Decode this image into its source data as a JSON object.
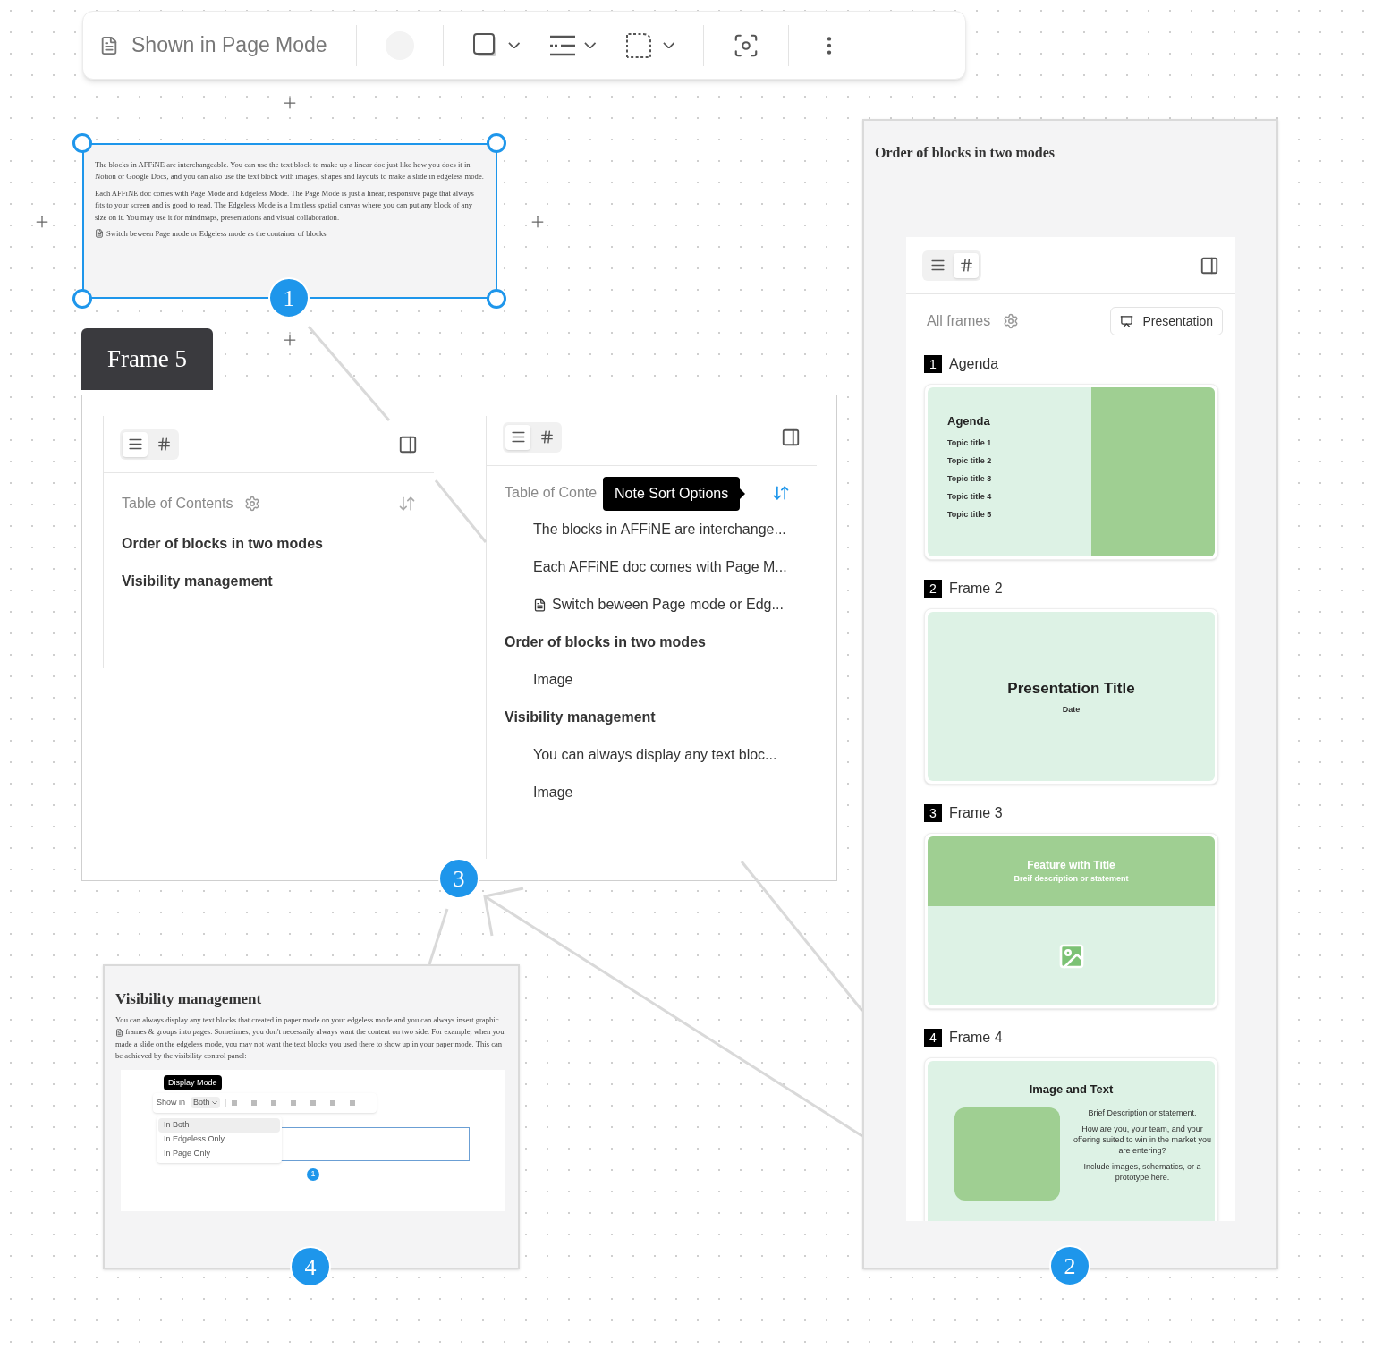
{
  "toolbar": {
    "label": "Shown in Page Mode"
  },
  "note_1": {
    "paragraphs": [
      "The blocks in AFFiNE are interchangeable. You can use the text block to make up a linear doc just like how you does it in Notion or Google Docs, and you can also use the text block with images, shapes and layouts to make a slide in edgeless mode.",
      "Each AFFiNE doc comes with Page Mode and Edgeless Mode. The Page Mode is just a linear, responsive page that always fits to your screen and is good to read. The Edgeless Mode is a limitless spatial canvas where you can put any block of any size on it. You may use it for mindmaps, presentations and visual collaboration."
    ],
    "link": "Switch beween Page mode or Edgeless mode as the container of blocks",
    "badge": "1"
  },
  "frame_label": "Frame 5",
  "frame_5": {
    "badge": "3",
    "left_panel": {
      "view_toggle": [
        {
          "kind": "outline",
          "selected": true
        },
        {
          "kind": "frames",
          "selected": false
        }
      ],
      "heading": "Table of Contents",
      "sort_active": false,
      "items": [
        "Order of blocks in two modes",
        "Visibility management"
      ]
    },
    "right_panel": {
      "view_toggle": [
        {
          "kind": "outline",
          "selected": true
        },
        {
          "kind": "frames",
          "selected": false
        }
      ],
      "heading": "Table of Conte",
      "tooltip": "Note Sort Options",
      "sort_active": true,
      "items": [
        {
          "kind": "child",
          "text": "The blocks in AFFiNE are interchange..."
        },
        {
          "kind": "child",
          "text": "Each AFFiNE doc comes with Page M..."
        },
        {
          "kind": "link",
          "text": "Switch beween Page mode or Edg..."
        },
        {
          "kind": "heading",
          "text": "Order of blocks in two modes"
        },
        {
          "kind": "child",
          "text": "Image"
        },
        {
          "kind": "heading",
          "text": "Visibility management"
        },
        {
          "kind": "child",
          "text": "You can always display any text bloc..."
        },
        {
          "kind": "child",
          "text": "Image"
        }
      ]
    }
  },
  "note_4": {
    "title": "Visibility management",
    "body_before": "You can always display any text blocks that created in paper mode on your edgeless mode and you can always insert graphic",
    "body_link": "frames & groups",
    "body_after": "into pages. Sometimes, you don't necessaily always want the content on two side. For example, when you made a slide on the edgeless mode, you may not want the text blocks you used there to show up in your paper mode. This can be achieved by the visibility control panel:",
    "screenshot": {
      "tooltip": "Display Mode",
      "show_in": "Show in",
      "value": "Both",
      "options": [
        {
          "label": "In Both",
          "selected": true
        },
        {
          "label": "In Edgeless Only",
          "selected": false
        },
        {
          "label": "In Page Only",
          "selected": false
        }
      ],
      "badge": "1"
    },
    "badge": "4"
  },
  "note_2": {
    "title": "Order of blocks in two modes",
    "badge": "2",
    "panel": {
      "view_toggle": [
        {
          "kind": "outline",
          "selected": false
        },
        {
          "kind": "frames",
          "selected": true
        }
      ],
      "filter": "All frames",
      "button": "Presentation",
      "frames": [
        {
          "number": "1",
          "name": "Agenda",
          "kind": "agenda",
          "title": "Agenda",
          "lines": [
            "Topic title 1",
            "Topic title 2",
            "Topic title 3",
            "Topic title 4",
            "Topic title 5"
          ]
        },
        {
          "number": "2",
          "name": "Frame 2",
          "kind": "title",
          "title": "Presentation Title",
          "lines": [
            "Date"
          ]
        },
        {
          "number": "3",
          "name": "Frame 3",
          "kind": "feature",
          "title": "Feature with Title",
          "lines": [
            "Breif description or statement"
          ]
        },
        {
          "number": "4",
          "name": "Frame 4",
          "kind": "image_text",
          "title": "Image and Text",
          "lines": [
            "Brief Description or statement.",
            "How are you, your team, and your offering suited to win in the market you are entering?",
            "Include images, schematics, or a prototype here."
          ]
        }
      ]
    }
  }
}
